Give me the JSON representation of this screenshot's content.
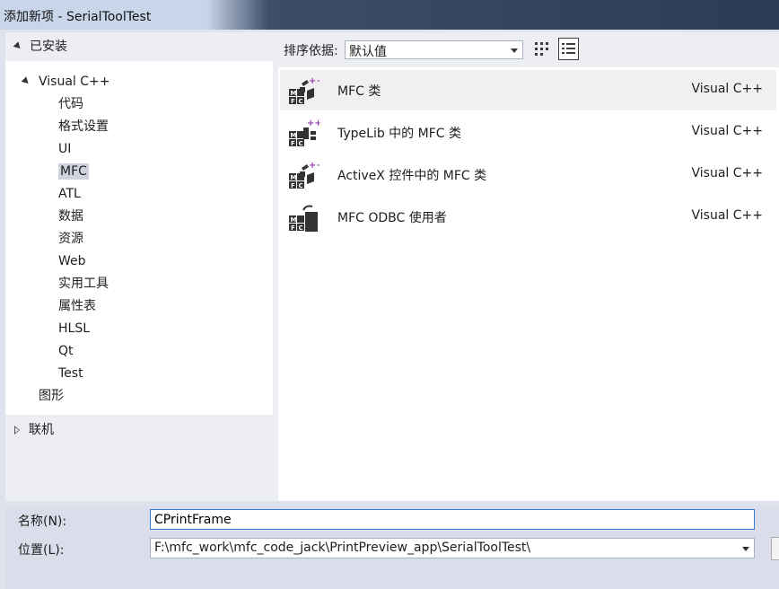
{
  "window": {
    "title": "添加新项 - SerialToolTest"
  },
  "tree": {
    "installed": "已安装",
    "visual_cpp": "Visual C++",
    "children": [
      "代码",
      "格式设置",
      "UI",
      "MFC",
      "ATL",
      "数据",
      "资源",
      "Web",
      "实用工具",
      "属性表",
      "HLSL",
      "Qt",
      "Test"
    ],
    "selected": "MFC",
    "graphics": "图形",
    "online": "联机"
  },
  "sort": {
    "label": "排序依据:",
    "value": "默认值"
  },
  "view_icons": [
    "grid-view-icon",
    "list-view-icon"
  ],
  "templates": [
    {
      "name": "MFC 类",
      "lang": "Visual C++",
      "icon": "mfc-class-icon",
      "selected": true
    },
    {
      "name": "TypeLib 中的 MFC 类",
      "lang": "Visual C++",
      "icon": "mfc-typelib-class-icon"
    },
    {
      "name": "ActiveX 控件中的 MFC 类",
      "lang": "Visual C++",
      "icon": "mfc-activex-class-icon"
    },
    {
      "name": "MFC ODBC 使用者",
      "lang": "Visual C++",
      "icon": "mfc-odbc-consumer-icon"
    }
  ],
  "form": {
    "name_label": "名称(N):",
    "name_value": "CPrintFrame",
    "location_label": "位置(L):",
    "location_value": "F:\\mfc_work\\mfc_code_jack\\PrintPreview_app\\SerialToolTest\\"
  },
  "colors": {
    "selection": "#cfd3de",
    "focus_border": "#3d7bd8",
    "icon_plus": "#9b3fb3"
  }
}
